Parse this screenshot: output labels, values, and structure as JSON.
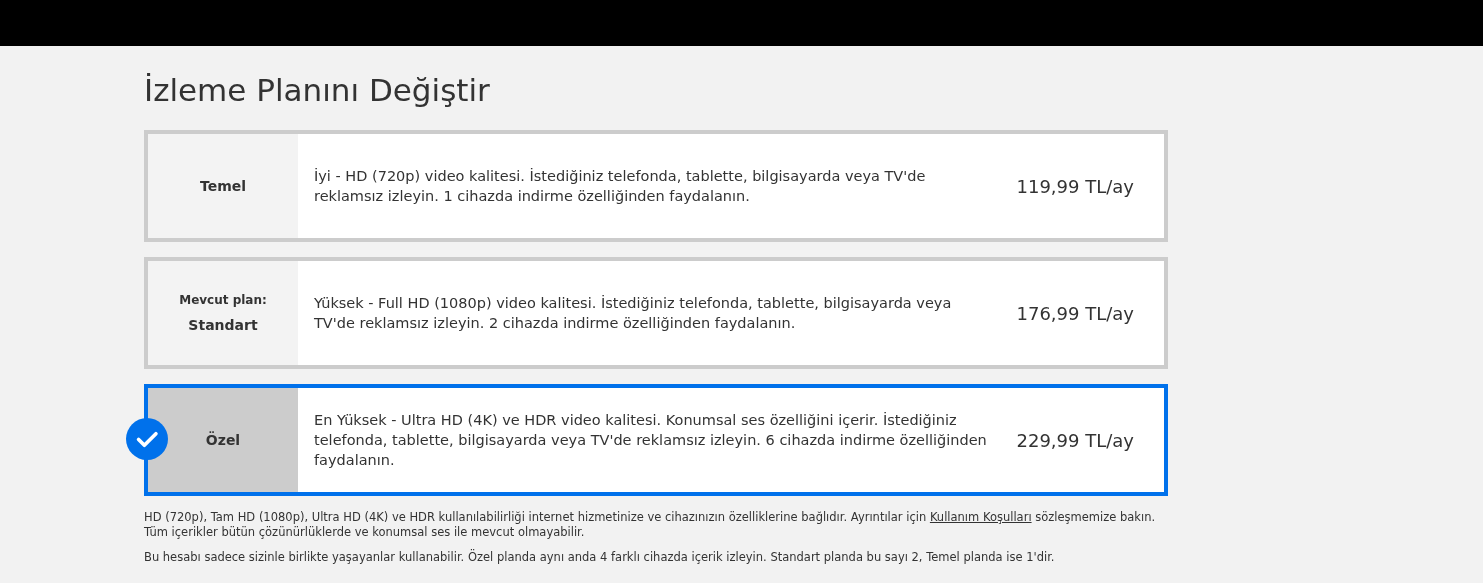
{
  "title": "İzleme Planını Değiştir",
  "plans": [
    {
      "name": "Temel",
      "description": "İyi - HD (720p) video kalitesi. İstediğiniz telefonda, tablette, bilgisayarda veya TV'de reklamsız izleyin. 1 cihazda indirme özelliğinden faydalanın.",
      "price": "119,99 TL/ay",
      "selected": false
    },
    {
      "current_label": "Mevcut plan:",
      "name": "Standart",
      "description": "Yüksek - Full HD (1080p) video kalitesi. İstediğiniz telefonda, tablette, bilgisayarda veya TV'de reklamsız izleyin. 2 cihazda indirme özelliğinden faydalanın.",
      "price": "176,99 TL/ay",
      "selected": false
    },
    {
      "name": "Özel",
      "description": "En Yüksek - Ultra HD (4K) ve HDR video kalitesi. Konumsal ses özelliğini içerir. İstediğiniz telefonda, tablette, bilgisayarda veya TV'de reklamsız izleyin. 6 cihazda indirme özelliğinden faydalanın.",
      "price": "229,99 TL/ay",
      "selected": true
    }
  ],
  "note": {
    "before": "HD (720p), Tam HD (1080p), Ultra HD (4K) ve HDR kullanılabilirliği internet hizmetinize ve cihazınızın özelliklerine bağlıdır. Ayrıntılar için",
    "link": "Kullanım Koşulları",
    "after": "sözleşmemize bakın. Tüm içerikler bütün çözünürlüklerde ve konumsal ses ile mevcut olmayabilir."
  },
  "note2": "Bu hesabı sadece sizinle birlikte yaşayanlar kullanabilir. Özel planda aynı anda 4 farklı cihazda içerik izleyin. Standart planda bu sayı 2, Temel planda ise 1'dir."
}
